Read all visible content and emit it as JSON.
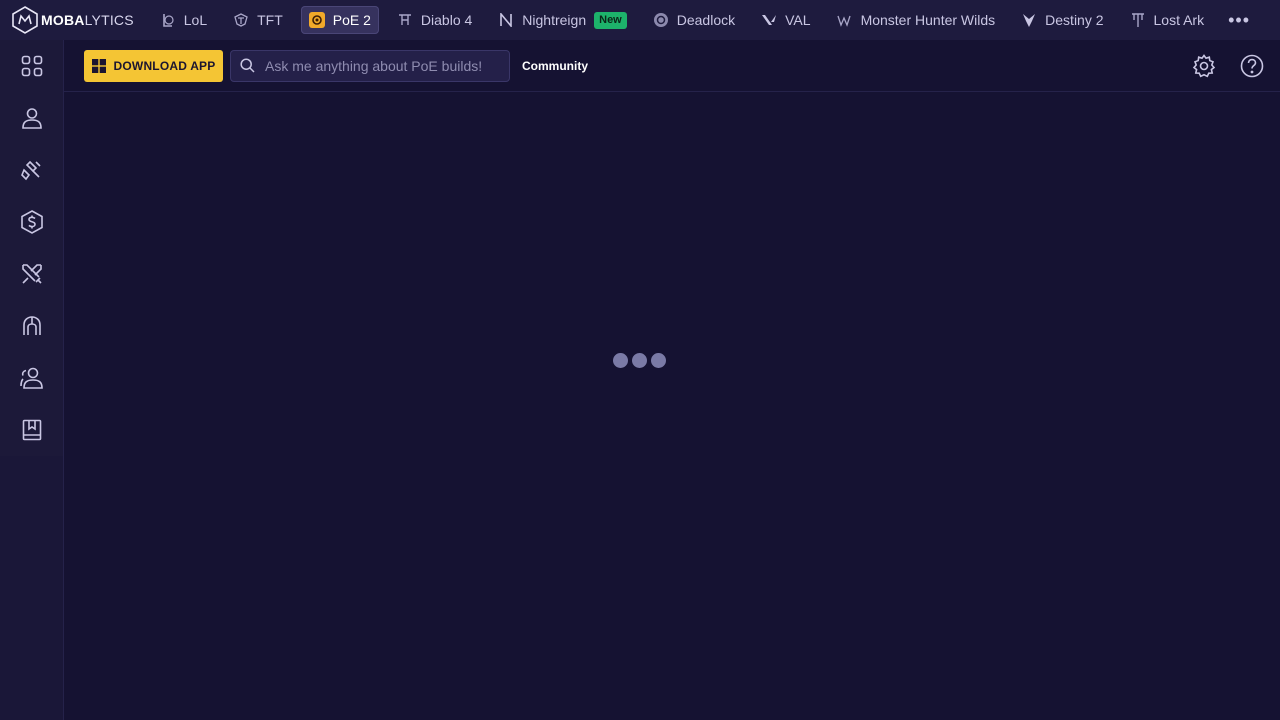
{
  "brand": {
    "bold": "MOBA",
    "light": "LYTICS"
  },
  "games": [
    {
      "label": "LoL",
      "icon": "lol-icon",
      "active": false
    },
    {
      "label": "TFT",
      "icon": "tft-icon",
      "active": false
    },
    {
      "label": "PoE 2",
      "icon": "poe2-icon",
      "active": true
    },
    {
      "label": "Diablo 4",
      "icon": "diablo-icon",
      "active": false
    },
    {
      "label": "Nightreign",
      "icon": "nightreign-icon",
      "active": false,
      "badge": "New"
    },
    {
      "label": "Deadlock",
      "icon": "deadlock-icon",
      "active": false
    },
    {
      "label": "VAL",
      "icon": "valorant-icon",
      "active": false
    },
    {
      "label": "Monster Hunter Wilds",
      "icon": "monster-hunter-icon",
      "active": false
    },
    {
      "label": "Destiny 2",
      "icon": "destiny-icon",
      "active": false
    },
    {
      "label": "Lost Ark",
      "icon": "lost-ark-icon",
      "active": false
    }
  ],
  "more_label": "•••",
  "sidebar": {
    "items": [
      {
        "icon": "grid-icon"
      },
      {
        "icon": "profile-icon"
      },
      {
        "icon": "builds-hammer-icon"
      },
      {
        "icon": "currency-icon"
      },
      {
        "icon": "crossed-swords-icon"
      },
      {
        "icon": "helmet-icon"
      },
      {
        "icon": "community-icon"
      },
      {
        "icon": "guide-book-icon"
      }
    ]
  },
  "header": {
    "download_label": "DOWNLOAD APP",
    "search_placeholder": "Ask me anything about PoE builds!",
    "community_label": "Community"
  },
  "colors": {
    "background": "#151232",
    "topnav": "#1e1b3e",
    "accent": "#f4c534",
    "badge": "#1db26b",
    "loader": "#7a7aa6"
  }
}
